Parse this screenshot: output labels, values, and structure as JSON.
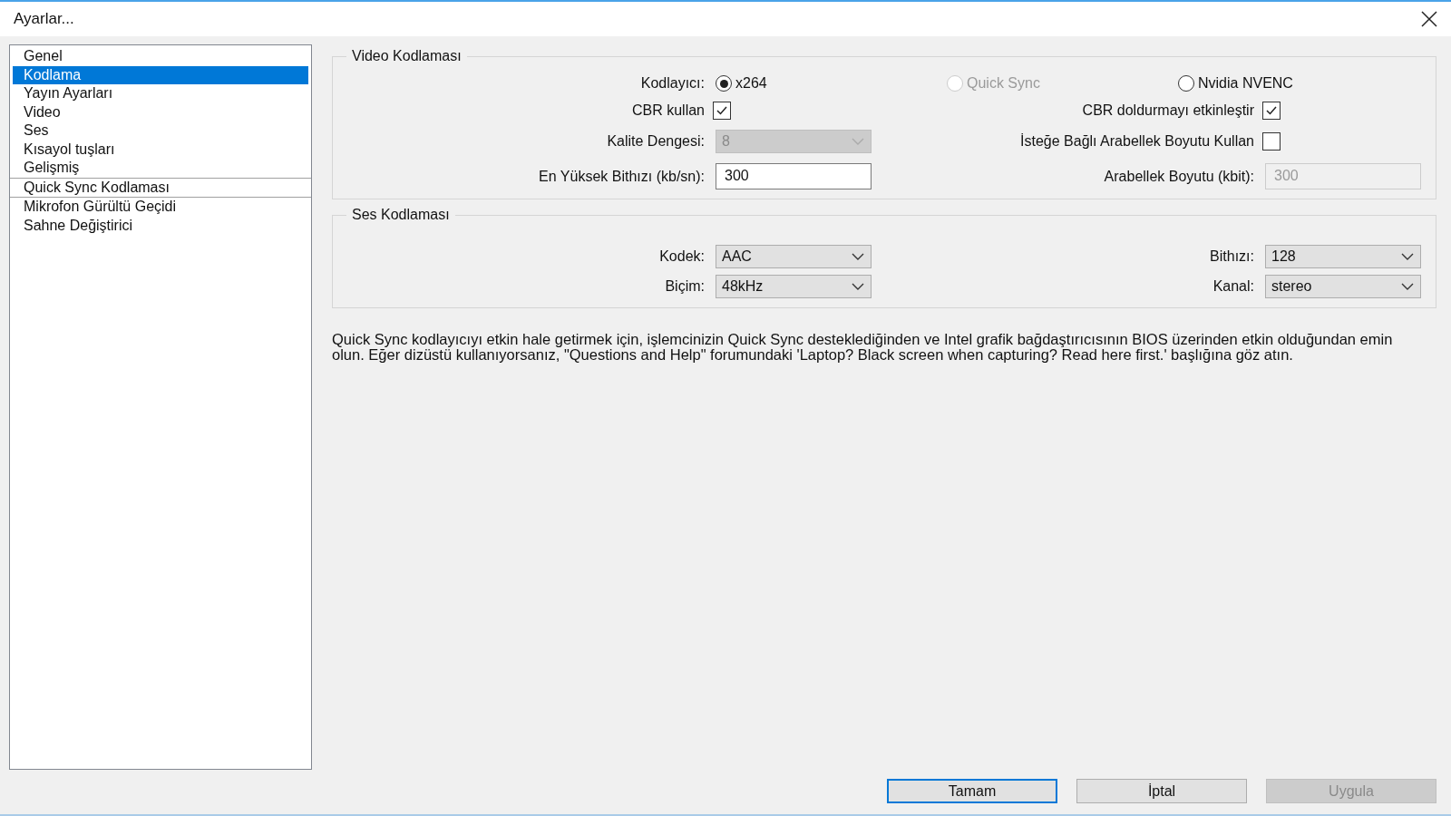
{
  "window": {
    "title": "Ayarlar..."
  },
  "sidebar": {
    "groups": [
      [
        {
          "label": "Genel",
          "selected": false
        },
        {
          "label": "Kodlama",
          "selected": true
        },
        {
          "label": "Yayın Ayarları",
          "selected": false
        },
        {
          "label": "Video",
          "selected": false
        },
        {
          "label": "Ses",
          "selected": false
        },
        {
          "label": "Kısayol tuşları",
          "selected": false
        },
        {
          "label": "Gelişmiş",
          "selected": false
        }
      ],
      [
        {
          "label": "Quick Sync Kodlaması",
          "selected": false
        }
      ],
      [
        {
          "label": "Mikrofon Gürültü Geçidi",
          "selected": false
        },
        {
          "label": "Sahne Değiştirici",
          "selected": false
        }
      ]
    ]
  },
  "video_encoding": {
    "title": "Video Kodlaması",
    "encoder": {
      "label": "Kodlayıcı:",
      "options": [
        {
          "label": "x264",
          "selected": true,
          "disabled": false
        },
        {
          "label": "Quick Sync",
          "selected": false,
          "disabled": true
        },
        {
          "label": "Nvidia NVENC",
          "selected": false,
          "disabled": false
        }
      ]
    },
    "rows": [
      {
        "left": {
          "kind": "checkbox",
          "label": "CBR kullan",
          "checked": true
        },
        "right": {
          "kind": "checkbox",
          "label": "CBR doldurmayı etkinleştir",
          "checked": true
        }
      },
      {
        "left": {
          "kind": "dropdown",
          "label": "Kalite Dengesi:",
          "value": "8",
          "disabled": true
        },
        "right": {
          "kind": "checkbox",
          "label": "İsteğe Bağlı Arabellek Boyutu Kullan",
          "checked": false
        }
      },
      {
        "left": {
          "kind": "input",
          "label": "En Yüksek Bithızı (kb/sn):",
          "value": "300",
          "disabled": false
        },
        "right": {
          "kind": "input",
          "label": "Arabellek Boyutu (kbit):",
          "value": "300",
          "disabled": true
        }
      }
    ]
  },
  "audio_encoding": {
    "title": "Ses Kodlaması",
    "rows": [
      {
        "left": {
          "kind": "dropdown",
          "label": "Kodek:",
          "value": "AAC",
          "disabled": false
        },
        "right": {
          "kind": "dropdown",
          "label": "Bithızı:",
          "value": "128",
          "disabled": false
        }
      },
      {
        "left": {
          "kind": "dropdown",
          "label": "Biçim:",
          "value": "48kHz",
          "disabled": false
        },
        "right": {
          "kind": "dropdown",
          "label": "Kanal:",
          "value": "stereo",
          "disabled": false
        }
      }
    ]
  },
  "note": "Quick Sync kodlayıcıyı etkin hale getirmek için, işlemcinizin Quick Sync desteklediğinden ve Intel grafik bağdaştırıcısının BIOS üzerinden etkin olduğundan emin olun. Eğer dizüstü kullanıyorsanız, \"Questions and Help\" forumundaki  'Laptop? Black screen when capturing? Read here first.' başlığına göz atın.",
  "buttons": [
    {
      "label": "Tamam",
      "default": true,
      "disabled": false
    },
    {
      "label": "İptal",
      "default": false,
      "disabled": false
    },
    {
      "label": "Uygula",
      "default": false,
      "disabled": true
    }
  ]
}
